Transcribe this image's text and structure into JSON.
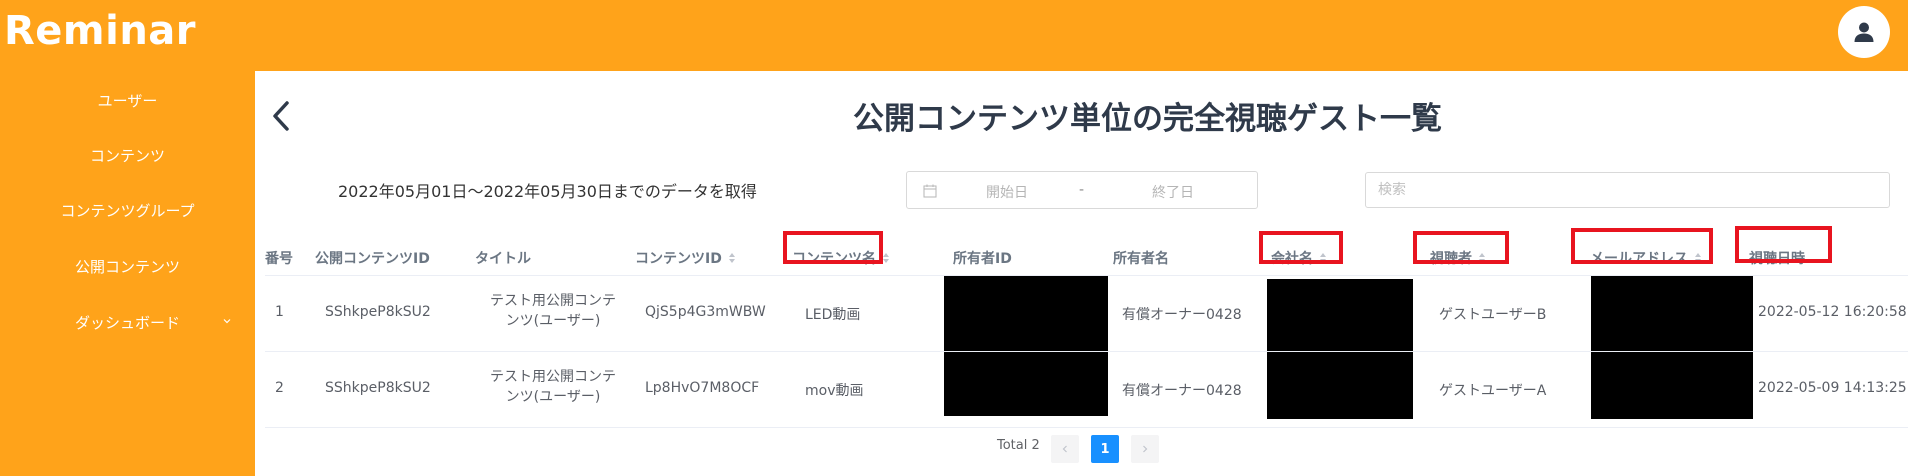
{
  "app": {
    "logo": "Reminar"
  },
  "sidebar": {
    "items": [
      {
        "label": "ユーザー"
      },
      {
        "label": "コンテンツ"
      },
      {
        "label": "コンテンツグループ"
      },
      {
        "label": "公開コンテンツ"
      },
      {
        "label": "ダッシュボード"
      }
    ]
  },
  "page": {
    "title": "公開コンテンツ単位の完全視聴ゲスト一覧",
    "range_text": "2022年05月01日～2022年05月30日までのデータを取得"
  },
  "filters": {
    "start_placeholder": "開始日",
    "separator": "-",
    "end_placeholder": "終了日",
    "search_placeholder": "検索"
  },
  "table": {
    "headers": {
      "no": "番号",
      "public_id": "公開コンテンツID",
      "title": "タイトル",
      "content_id": "コンテンツID",
      "content_name": "コンテンツ名",
      "owner_id": "所有者ID",
      "owner_name": "所有者名",
      "company": "会社名",
      "viewer": "視聴者",
      "email": "メールアドレス",
      "viewed_at": "視聴日時"
    },
    "rows": [
      {
        "no": "1",
        "public_id": "SShkpeP8kSU2",
        "title_line1": "テスト用公開コンテ",
        "title_line2": "ンツ(ユーザー)",
        "content_id": "QjS5p4G3mWBW",
        "content_name": "LED動画",
        "owner_name": "有償オーナー0428",
        "viewer": "ゲストユーザーB",
        "viewed_at": "2022-05-12 16:20:58"
      },
      {
        "no": "2",
        "public_id": "SShkpeP8kSU2",
        "title_line1": "テスト用公開コンテ",
        "title_line2": "ンツ(ユーザー)",
        "content_id": "Lp8HvO7M8OCF",
        "content_name": "mov動画",
        "owner_name": "有償オーナー0428",
        "viewer": "ゲストユーザーA",
        "viewed_at": "2022-05-09 14:13:25"
      }
    ]
  },
  "pagination": {
    "total": "Total 2",
    "current": "1"
  },
  "colors": {
    "brand": "#ffa31a",
    "highlight": "#e8141f",
    "active_page": "#1890ff"
  },
  "icons": {
    "avatar": "user-icon",
    "back": "chevron-left-icon",
    "dashboard_expand": "chevron-down-icon",
    "calendar": "calendar-icon",
    "sort": "sort-icon"
  }
}
